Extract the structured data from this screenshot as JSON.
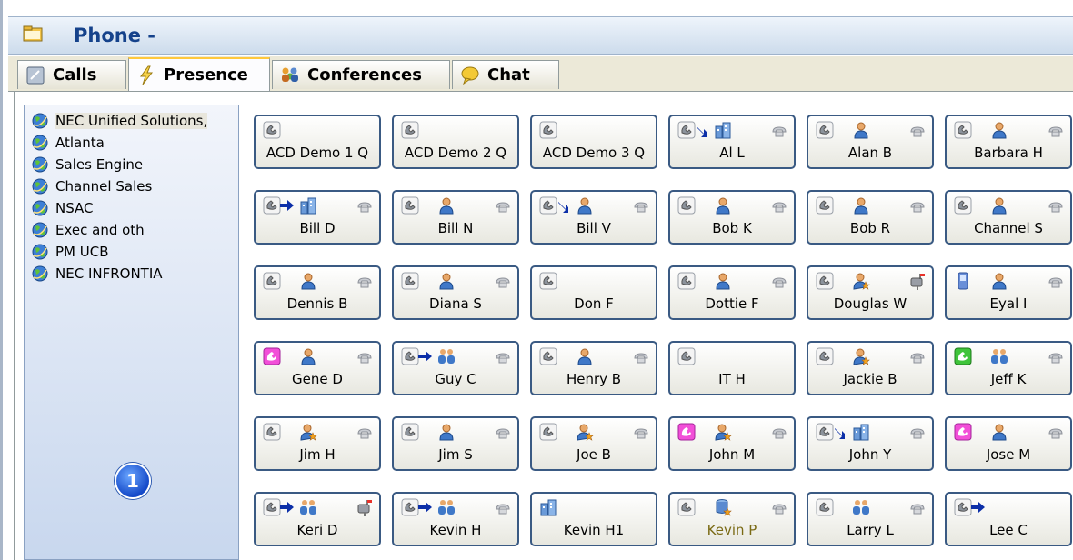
{
  "window": {
    "title": "Phone -"
  },
  "tabs": [
    {
      "label": "Calls",
      "icon": "calls-icon",
      "active": false
    },
    {
      "label": "Presence",
      "icon": "lightning-icon",
      "active": true
    },
    {
      "label": "Conferences",
      "icon": "conference-icon",
      "active": false
    },
    {
      "label": "Chat",
      "icon": "chat-bubble-icon",
      "active": false
    }
  ],
  "tree": {
    "items": [
      {
        "label": "NEC Unified Solutions,",
        "selected": true
      },
      {
        "label": "Atlanta"
      },
      {
        "label": "Sales Engine"
      },
      {
        "label": "Channel Sales"
      },
      {
        "label": "NSAC"
      },
      {
        "label": "Exec and oth"
      },
      {
        "label": "PM UCB"
      },
      {
        "label": "NEC INFRONTIA"
      }
    ],
    "badge": "1"
  },
  "contacts": [
    {
      "name": "ACD Demo 1 Q",
      "icons": [
        "phone"
      ]
    },
    {
      "name": "ACD Demo 2 Q",
      "icons": [
        "phone"
      ]
    },
    {
      "name": "ACD Demo 3 Q",
      "icons": [
        "phone"
      ]
    },
    {
      "name": "Al L",
      "icons": [
        "phone",
        "arrow-down",
        "building",
        "handset"
      ]
    },
    {
      "name": "Alan B",
      "icons": [
        "phone",
        "person",
        "handset"
      ]
    },
    {
      "name": "Barbara H",
      "icons": [
        "phone",
        "person",
        "handset"
      ]
    },
    {
      "name": "Bill D",
      "icons": [
        "phone",
        "arrow-right",
        "building",
        "handset"
      ]
    },
    {
      "name": "Bill N",
      "icons": [
        "phone",
        "person",
        "handset"
      ]
    },
    {
      "name": "Bill V",
      "icons": [
        "phone",
        "arrow-down",
        "person",
        "handset"
      ]
    },
    {
      "name": "Bob K",
      "icons": [
        "phone",
        "person",
        "handset"
      ]
    },
    {
      "name": "Bob R",
      "icons": [
        "phone",
        "person",
        "handset"
      ]
    },
    {
      "name": "Channel S",
      "icons": [
        "phone",
        "person",
        "handset"
      ]
    },
    {
      "name": "Dennis B",
      "icons": [
        "phone",
        "person",
        "handset"
      ]
    },
    {
      "name": "Diana S",
      "icons": [
        "phone",
        "person",
        "handset"
      ]
    },
    {
      "name": "Don F",
      "icons": [
        "phone"
      ]
    },
    {
      "name": "Dottie F",
      "icons": [
        "phone",
        "person",
        "handset"
      ]
    },
    {
      "name": "Douglas W",
      "icons": [
        "phone",
        "person-away",
        "mailbox"
      ]
    },
    {
      "name": "Eyal I",
      "icons": [
        "mobile",
        "person",
        "handset"
      ]
    },
    {
      "name": "Gene D",
      "icons": [
        "pink-phone",
        "person",
        "handset"
      ]
    },
    {
      "name": "Guy C",
      "icons": [
        "phone",
        "arrow-right",
        "group",
        "handset"
      ]
    },
    {
      "name": "Henry B",
      "icons": [
        "phone",
        "person",
        "handset"
      ]
    },
    {
      "name": "IT H",
      "icons": [
        "phone"
      ]
    },
    {
      "name": "Jackie B",
      "icons": [
        "phone",
        "person-away",
        "handset"
      ]
    },
    {
      "name": "Jeff K",
      "icons": [
        "green-phone",
        "group",
        "handset"
      ]
    },
    {
      "name": "Jim H",
      "icons": [
        "phone",
        "person-away",
        "handset"
      ]
    },
    {
      "name": "Jim S",
      "icons": [
        "phone",
        "person",
        "handset"
      ]
    },
    {
      "name": "Joe B",
      "icons": [
        "phone",
        "person-away",
        "handset"
      ]
    },
    {
      "name": "John M",
      "icons": [
        "pink-phone",
        "person-away",
        "handset"
      ]
    },
    {
      "name": "John Y",
      "icons": [
        "phone",
        "arrow-down",
        "building",
        "handset"
      ]
    },
    {
      "name": "Jose M",
      "icons": [
        "pink-phone",
        "person",
        "handset"
      ]
    },
    {
      "name": "Keri D",
      "icons": [
        "phone",
        "arrow-right",
        "group",
        "mailbox"
      ]
    },
    {
      "name": "Kevin H",
      "icons": [
        "phone",
        "arrow-right",
        "group",
        "handset"
      ]
    },
    {
      "name": "Kevin H1",
      "icons": [
        "building"
      ]
    },
    {
      "name": "Kevin P",
      "icons": [
        "phone",
        "database-away",
        "handset"
      ],
      "highlight": true
    },
    {
      "name": "Larry L",
      "icons": [
        "phone",
        "group",
        "handset"
      ]
    },
    {
      "name": "Lee C",
      "icons": [
        "phone",
        "arrow-right"
      ]
    }
  ]
}
